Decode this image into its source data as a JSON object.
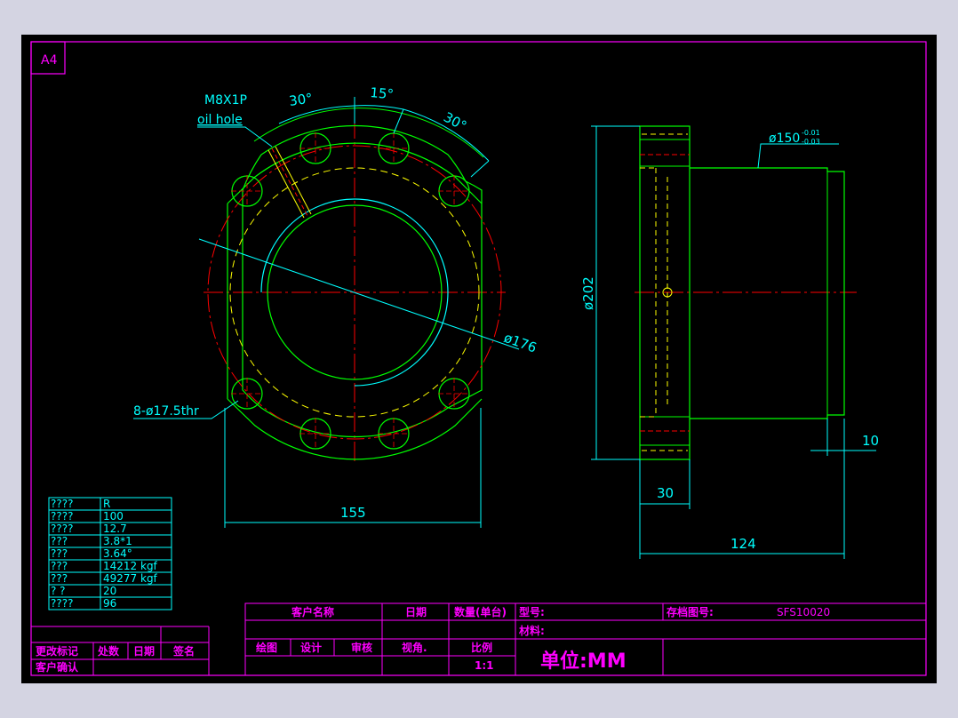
{
  "colors": {
    "magenta": "#ff00ff",
    "cyan": "#00ffff",
    "green": "#00ff00",
    "red": "#ff0000",
    "yellow": "#ffff00",
    "white": "#ffffff",
    "background": "#000000"
  },
  "sheet": {
    "size": "A4"
  },
  "front_view": {
    "thread_label": "M8X1P",
    "thread_sublabel": "oil hole",
    "angle_left": "30°",
    "angle_mid": "15°",
    "angle_right": "30°",
    "pcd_label": "ø176",
    "holes_label": "8-ø17.5thr",
    "width_label": "155"
  },
  "side_view": {
    "dia_label": "ø202",
    "shaft_label": "ø150",
    "tol_upper": "-0.01",
    "tol_lower": "-0.03",
    "flange_label": "30",
    "length_label": "124",
    "lip_label": "10"
  },
  "spec_table": {
    "rows": [
      {
        "k": "????",
        "v": "R"
      },
      {
        "k": "????",
        "v": "100"
      },
      {
        "k": "????",
        "v": "12.7"
      },
      {
        "k": " ???",
        "v": "3.8*1"
      },
      {
        "k": " ???",
        "v": "3.64°"
      },
      {
        "k": " ???",
        "v": "14212 kgf"
      },
      {
        "k": " ???",
        "v": "49277 kgf"
      },
      {
        "k": " ?  ?",
        "v": "20"
      },
      {
        "k": "????",
        "v": "96"
      }
    ]
  },
  "revision_block": {
    "change_mark": "更改标记",
    "count": "处数",
    "date": "日期",
    "sign": "签名",
    "customer_confirm": "客户确认"
  },
  "title_block": {
    "customer_name": "客户名称",
    "date": "日期",
    "qty": "数量(单台)",
    "model": "型号:",
    "archive": "存档图号:",
    "archive_no": "SFS10020",
    "material": "材料:",
    "drawn": "绘图",
    "design": "设计",
    "check": "审核",
    "view": "视角.",
    "scale": "比例",
    "scale_value": "1:1",
    "unit": "单位:MM"
  }
}
